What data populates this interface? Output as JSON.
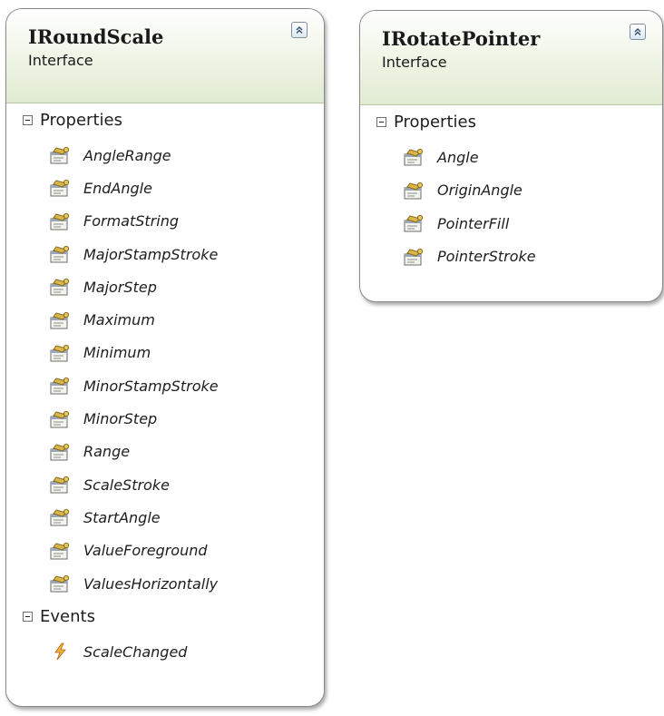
{
  "shapes": [
    {
      "title": "IRoundScale",
      "kind": "Interface",
      "sections": [
        {
          "label": "Properties",
          "members": [
            "AngleRange",
            "EndAngle",
            "FormatString",
            "MajorStampStroke",
            "MajorStep",
            "Maximum",
            "Minimum",
            "MinorStampStroke",
            "MinorStep",
            "Range",
            "ScaleStroke",
            "StartAngle",
            "ValueForeground",
            "ValuesHorizontally"
          ]
        },
        {
          "label": "Events",
          "members": [
            "ScaleChanged"
          ]
        }
      ]
    },
    {
      "title": "IRotatePointer",
      "kind": "Interface",
      "sections": [
        {
          "label": "Properties",
          "members": [
            "Angle",
            "OriginAngle",
            "PointerFill",
            "PointerStroke"
          ]
        }
      ]
    }
  ],
  "icons": {
    "collapse": "chevron-up-icon",
    "section_toggle": "minus-box-icon",
    "property": "property-icon",
    "event": "event-icon"
  },
  "colors": {
    "header_gradient_bottom": "#e1ebd2",
    "border": "#8a8a8a"
  }
}
